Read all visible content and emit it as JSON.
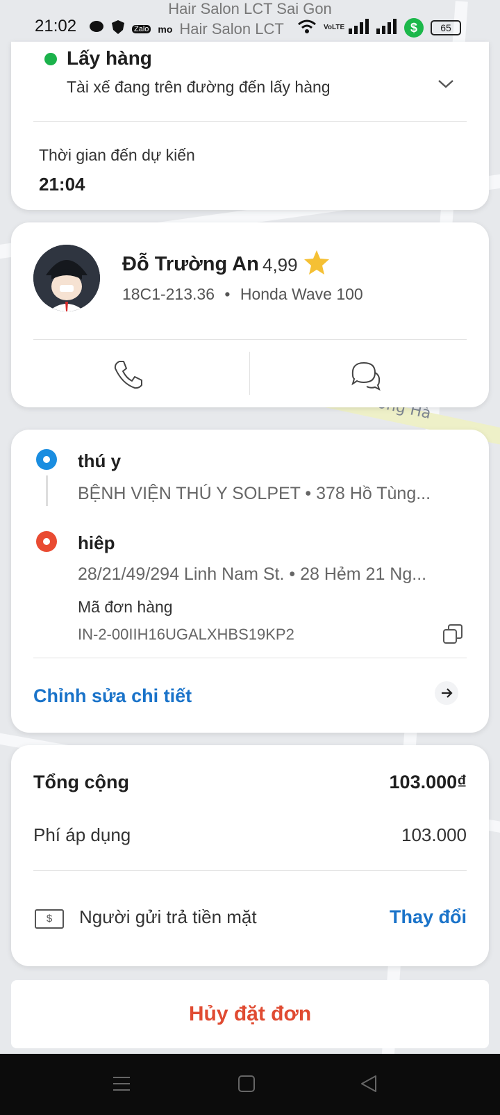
{
  "status_bar": {
    "time": "21:02",
    "map_place_top": "Hair Salon LCT Sai Gon",
    "map_place_bar": "Hair Salon LCT",
    "map_place_sub": "Sài Gòn",
    "notif_icons": [
      "messenger-icon",
      "shield-icon",
      "zalo-icon",
      "momo-icon",
      "momo-icon"
    ],
    "icon_zalo": "Zalo",
    "icon_momo": "mo",
    "volte": "VoLTE",
    "battery": "65",
    "shield_label": "$"
  },
  "map": {
    "street_fragment": "Đường Hà",
    "colors": {
      "background": "#e7e9ec"
    }
  },
  "trip_status": {
    "title": "Lấy hàng",
    "subtitle": "Tài xế đang trên đường đến lấy hàng",
    "eta_label": "Thời gian đến dự kiến",
    "eta_time": "21:04",
    "status_color": "#1bb24b"
  },
  "driver": {
    "name": "Đỗ Trường An",
    "rating": "4,99",
    "plate": "18C1-213.36",
    "separator": "•",
    "vehicle": "Honda Wave 100"
  },
  "route": {
    "pickup": {
      "name": "thú y",
      "address": "BỆNH VIỆN THÚ Y SOLPET  •  378 Hồ Tùng...",
      "color": "#1a8de0"
    },
    "dropoff": {
      "name": "hiêp",
      "address": "28/21/49/294 Linh Nam St.  •  28 Hẻm 21 Ng...",
      "color": "#e94b32"
    },
    "order_code_label": "Mã đơn hàng",
    "order_code": "IN-2-00IIH16UGALXHBS19KP2",
    "edit_label": "Chỉnh sửa chi tiết"
  },
  "payment": {
    "total_label": "Tổng cộng",
    "total_value": "103.000₫",
    "fee_label": "Phí áp dụng",
    "fee_value": "103.000",
    "cash_icon_label": "$",
    "method": "Người gửi trả tiền mặt",
    "change_label": "Thay đổi"
  },
  "cancel_label": "Hủy đặt đơn",
  "accent_color": "#1a73c9",
  "cancel_color": "#e04b32"
}
